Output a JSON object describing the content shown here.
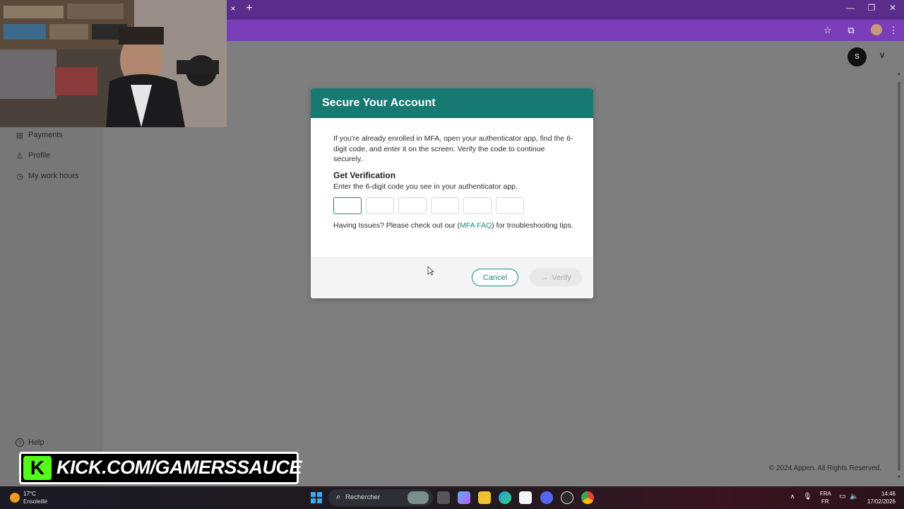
{
  "browser": {
    "tab_close_icon": "×",
    "new_tab_icon": "+",
    "window_controls": {
      "minimize": "—",
      "restore": "❐",
      "close": "✕"
    },
    "toolbar_icons": {
      "bookmark": "☆",
      "extensions": "⧉",
      "menu": "⋮"
    },
    "colors": {
      "tabbar": "#5a2d8a",
      "toolbar": "#7a3fb8"
    }
  },
  "sidebar": {
    "items": [
      {
        "label": "Payments",
        "icon": "payments-icon",
        "glyph": "▤"
      },
      {
        "label": "Profile",
        "icon": "profile-icon",
        "glyph": "♙"
      },
      {
        "label": "My work hours",
        "icon": "clock-icon",
        "glyph": "◷"
      }
    ],
    "bottom_items": [
      {
        "label": "Help",
        "icon": "help-icon",
        "glyph": "?"
      }
    ]
  },
  "header": {
    "user_initial": "S",
    "chevron": "∨"
  },
  "modal": {
    "title": "Secure Your Account",
    "intro": "If you're already enrolled in MFA, open your authenticator app, find the 6-digit code, and enter it on the screen. Verify the code to continue securely.",
    "verification_heading": "Get Verification",
    "verification_sub": "Enter the 6-digit code you see in your authenticator app.",
    "code_length": 6,
    "issues_prefix": "Having Issues? Please check out our (",
    "issues_link": "MFA FAQ",
    "issues_suffix": ") for troubleshooting tips.",
    "cancel_label": "Cancel",
    "verify_label": "Verify",
    "verify_icon": "→",
    "accent_color": "#167a72"
  },
  "footer": {
    "copyright": "© 2024 Appen. All Rights Reserved."
  },
  "overlay": {
    "kick_logo": "K",
    "kick_text": "KICK.COM/GAMERSSAUCE",
    "kick_color": "#53fc18"
  },
  "taskbar": {
    "weather_temp": "17°C",
    "weather_desc": "Ensoleillé",
    "search_placeholder": "Rechercher",
    "lang_line1": "FRA",
    "lang_line2": "FR",
    "time": "14:46",
    "date": "17/02/2026"
  }
}
